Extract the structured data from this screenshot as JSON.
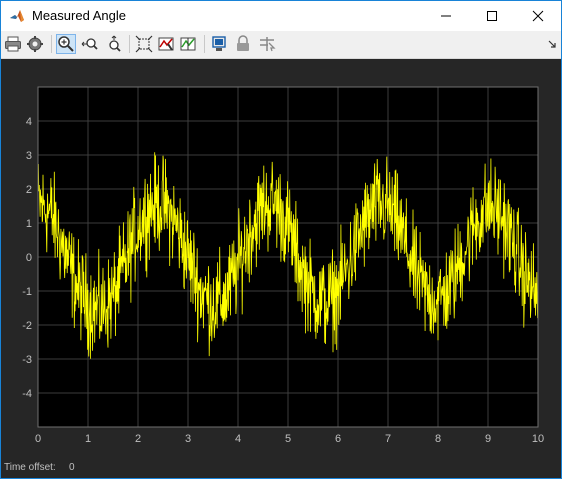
{
  "window": {
    "title": "Measured Angle"
  },
  "toolbar": {
    "buttons": [
      {
        "name": "print-icon"
      },
      {
        "name": "settings-icon"
      },
      {
        "name": "zoom-in-icon",
        "active": true
      },
      {
        "name": "zoom-x-icon"
      },
      {
        "name": "zoom-y-icon"
      },
      {
        "name": "scale-axes-icon"
      },
      {
        "name": "triggers-icon"
      },
      {
        "name": "cursor-measurements-icon"
      },
      {
        "name": "highlight-simulink-block-icon"
      },
      {
        "name": "lock-icon"
      },
      {
        "name": "signal-selector-icon"
      }
    ]
  },
  "status": {
    "label": "Time offset:",
    "value": "0"
  },
  "colors": {
    "background": "#262626",
    "axes": "#000000",
    "grid": "#3d3d3d",
    "line": "#ffff00",
    "tick_text": "#bfbfbf"
  },
  "chart_data": {
    "type": "line",
    "title": "",
    "xlabel": "",
    "ylabel": "",
    "xlim": [
      0,
      10
    ],
    "ylim": [
      -5,
      5
    ],
    "x_ticks": [
      0,
      1,
      2,
      3,
      4,
      5,
      6,
      7,
      8,
      9,
      10
    ],
    "y_ticks": [
      4,
      3,
      2,
      1,
      0,
      -1,
      -2,
      -3,
      -4
    ],
    "grid": true,
    "series": [
      {
        "color": "#ffff00",
        "x": [
          0,
          0.25,
          0.5,
          0.75,
          1,
          1.25,
          1.5,
          1.75,
          2,
          2.25,
          2.5,
          2.75,
          3,
          3.25,
          3.5,
          3.75,
          4,
          4.25,
          4.5,
          4.75,
          5,
          5.25,
          5.5,
          5.75,
          6,
          6.25,
          6.5,
          6.75,
          7,
          7.25,
          7.5,
          7.75,
          8,
          8.25,
          8.5,
          8.75,
          9,
          9.25,
          9.5,
          9.75,
          10
        ],
        "y": [
          1.6,
          1.3,
          0.3,
          -0.8,
          -1.4,
          -1.6,
          -1.2,
          -0.2,
          0.9,
          1.5,
          1.6,
          1.0,
          0.0,
          -1.0,
          -1.4,
          -1.2,
          -0.3,
          0.8,
          1.5,
          1.6,
          0.9,
          -0.3,
          -1.1,
          -1.4,
          -1.0,
          -0.1,
          0.9,
          1.5,
          1.5,
          0.8,
          -0.3,
          -1.1,
          -1.3,
          -0.9,
          0.1,
          1.0,
          1.5,
          1.3,
          0.4,
          -0.6,
          -1.2
        ],
        "noise_amplitude": 0.9
      }
    ]
  }
}
